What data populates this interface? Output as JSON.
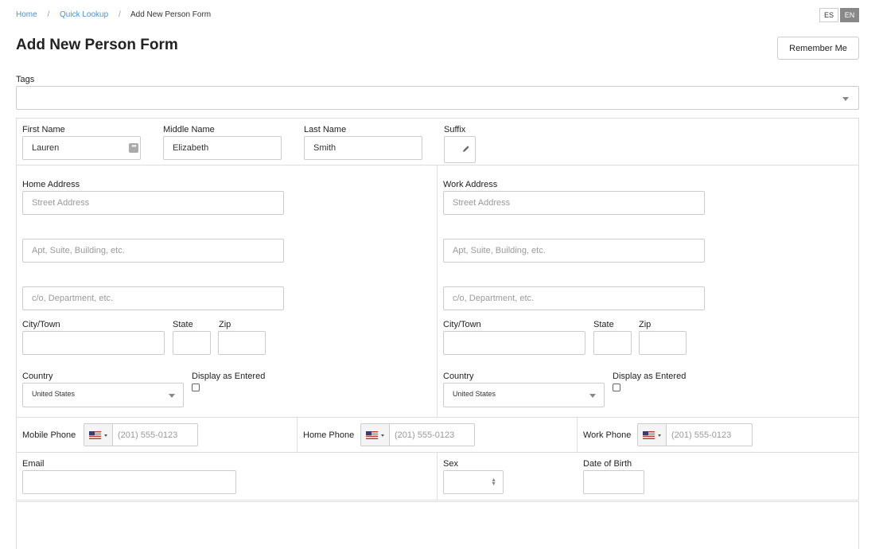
{
  "breadcrumb": {
    "home": "Home",
    "quick_lookup": "Quick Lookup",
    "current": "Add New Person Form",
    "separator": "/"
  },
  "lang": {
    "es": "ES",
    "en": "EN",
    "active": "EN"
  },
  "page_title": "Add New Person Form",
  "remember_me": "Remember Me",
  "tags": {
    "label": "Tags",
    "value": ""
  },
  "name": {
    "first_label": "First Name",
    "first_value": "Lauren",
    "middle_label": "Middle Name",
    "middle_value": "Elizabeth",
    "last_label": "Last Name",
    "last_value": "Smith",
    "suffix_label": "Suffix",
    "suffix_value": ""
  },
  "home_address": {
    "label": "Home Address",
    "street_placeholder": "Street Address",
    "apt_placeholder": "Apt, Suite, Building, etc.",
    "co_placeholder": "c/o, Department, etc.",
    "city_label": "City/Town",
    "state_label": "State",
    "zip_label": "Zip",
    "country_label": "Country",
    "country_value": "United States",
    "display_label": "Display as Entered"
  },
  "work_address": {
    "label": "Work Address",
    "street_placeholder": "Street Address",
    "apt_placeholder": "Apt, Suite, Building, etc.",
    "co_placeholder": "c/o, Department, etc.",
    "city_label": "City/Town",
    "state_label": "State",
    "zip_label": "Zip",
    "country_label": "Country",
    "country_value": "United States",
    "display_label": "Display as Entered"
  },
  "phones": {
    "mobile_label": "Mobile Phone",
    "home_label": "Home Phone",
    "work_label": "Work Phone",
    "placeholder": "(201) 555-0123"
  },
  "email_label": "Email",
  "sex_label": "Sex",
  "dob_label": "Date of Birth",
  "icons": {
    "flag": "us-flag-icon",
    "caret": "chevron-down-icon",
    "pencil": "pencil-icon",
    "dots": "more-dots-icon",
    "stepper": "up-down-stepper-icon"
  },
  "colors": {
    "link": "#4a90d9",
    "border": "#cccccc",
    "active_lang": "#888888"
  }
}
